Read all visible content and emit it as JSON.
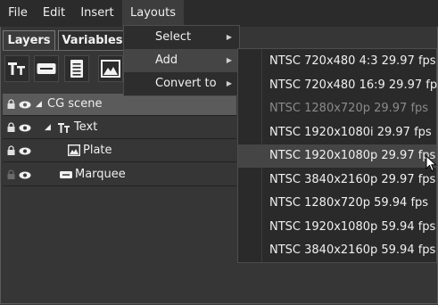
{
  "menubar": {
    "items": [
      {
        "label": "File"
      },
      {
        "label": "Edit"
      },
      {
        "label": "Insert"
      },
      {
        "label": "Layouts"
      }
    ]
  },
  "tabs": [
    {
      "label": "Layers",
      "active": true
    },
    {
      "label": "Variables",
      "active": false
    }
  ],
  "toolbar": {
    "icons": [
      "text-tool-icon",
      "textbox-tool-icon",
      "document-tool-icon",
      "image-tool-icon"
    ]
  },
  "tree": {
    "rows": [
      {
        "label": "CG scene",
        "icon": "",
        "selected": true
      },
      {
        "label": "Text",
        "icon": "text-layer-icon",
        "selected": false
      },
      {
        "label": "Plate",
        "icon": "image-layer-icon",
        "selected": false
      },
      {
        "label": "Marquee",
        "icon": "marquee-layer-icon",
        "selected": false
      }
    ]
  },
  "layouts_menu": {
    "items": [
      {
        "label": "Select",
        "highlighted": false
      },
      {
        "label": "Add",
        "highlighted": true
      },
      {
        "label": "Convert to",
        "highlighted": false
      }
    ]
  },
  "add_menu": {
    "items": [
      {
        "label": "NTSC 720x480 4:3 29.97 fps",
        "enabled": true,
        "highlighted": false
      },
      {
        "label": "NTSC 720x480 16:9 29.97 fps",
        "enabled": true,
        "highlighted": false
      },
      {
        "label": "NTSC 1280x720p 29.97 fps",
        "enabled": false,
        "highlighted": false
      },
      {
        "label": "NTSC 1920x1080i 29.97 fps",
        "enabled": true,
        "highlighted": false
      },
      {
        "label": "NTSC 1920x1080p 29.97 fps",
        "enabled": true,
        "highlighted": true
      },
      {
        "label": "NTSC 3840x2160p 29.97 fps",
        "enabled": true,
        "highlighted": false
      },
      {
        "label": "NTSC 1280x720p 59.94 fps",
        "enabled": true,
        "highlighted": false
      },
      {
        "label": "NTSC 1920x1080p 59.94 fps",
        "enabled": true,
        "highlighted": false
      },
      {
        "label": "NTSC 3840x2160p 59.94 fps",
        "enabled": true,
        "highlighted": false
      }
    ]
  }
}
